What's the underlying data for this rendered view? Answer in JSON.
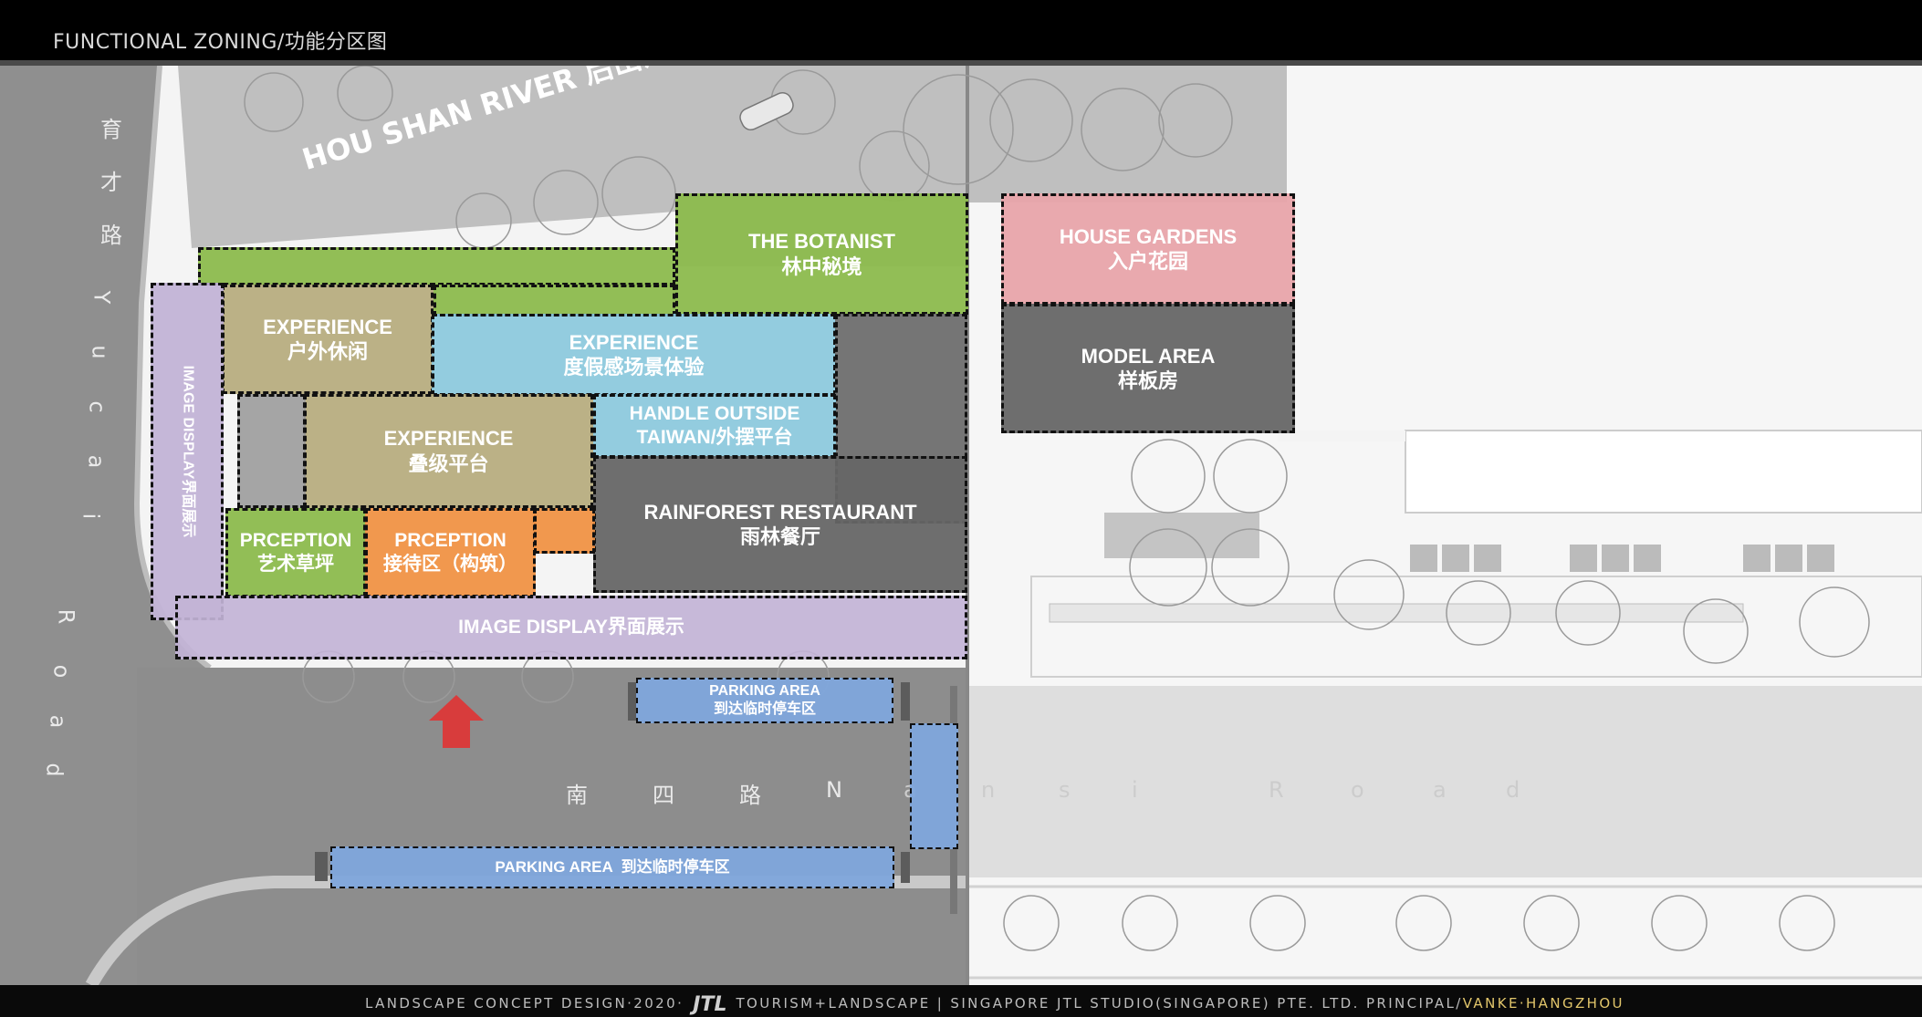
{
  "header": {
    "title": "FUNCTIONAL ZONING/功能分区图"
  },
  "river_label": "HOU SHAN RIVER 后山河",
  "road_west": {
    "chars": [
      "育",
      "才",
      "路",
      "Y",
      "u",
      "c",
      "a",
      "i",
      "R",
      "o",
      "a",
      "d"
    ]
  },
  "road_south": {
    "chars": [
      "南",
      "四",
      "路",
      "N",
      "a",
      "n",
      "s",
      "i",
      "R",
      "o",
      "a",
      "d"
    ]
  },
  "zones": {
    "botanist": {
      "en": "THE BOTANIST",
      "cn": "林中秘境"
    },
    "house_gardens": {
      "en": "HOUSE GARDENS",
      "cn": "入户花园"
    },
    "model_area": {
      "en": "MODEL AREA",
      "cn": "样板房"
    },
    "experience_outdoor": {
      "en": "EXPERIENCE",
      "cn": "户外休闲"
    },
    "experience_resort": {
      "en": "EXPERIENCE",
      "cn": "度假感场景体验"
    },
    "experience_terrace": {
      "en": "EXPERIENCE",
      "cn": "叠级平台"
    },
    "handle_outside": {
      "en": "HANDLE OUTSIDE",
      "cn": "TAIWAN/外摆平台"
    },
    "rainforest": {
      "en": "RAINFOREST RESTAURANT",
      "cn": "雨林餐厅"
    },
    "perception_lawn": {
      "en": "PRCEPTION",
      "cn": "艺术草坪"
    },
    "perception_reception": {
      "en": "PRCEPTION",
      "cn": "接待区（构筑）"
    },
    "image_display_vertical": {
      "text": "IMAGE DISPLAY界面展示"
    },
    "image_display_bottom": {
      "text": "IMAGE DISPLAY界面展示"
    },
    "parking_upper": {
      "en": "PARKING AREA",
      "cn": "到达临时停车区"
    },
    "parking_lower": {
      "text": "PARKING AREA  到达临时停车区"
    }
  },
  "colors": {
    "green": "#8cbb4d",
    "pink": "#e8a4aa",
    "gray": "#666666",
    "tan": "#b7ad7f",
    "blue": "#8dc9dd",
    "orange": "#f09245",
    "purple": "#c2b3d6",
    "parking_blue": "#7fa7dc",
    "arrow_red": "#d83c3c",
    "footer_highlight": "#e2c66b"
  },
  "footer": {
    "left": "LANDSCAPE CONCEPT DESIGN·2020·",
    "logo": "JTL",
    "middle": "TOURISM+LANDSCAPE | SINGAPORE JTL STUDIO(SINGAPORE) PTE. LTD. PRINCIPAL/",
    "highlight": "VANKE·HANGZHOU"
  }
}
